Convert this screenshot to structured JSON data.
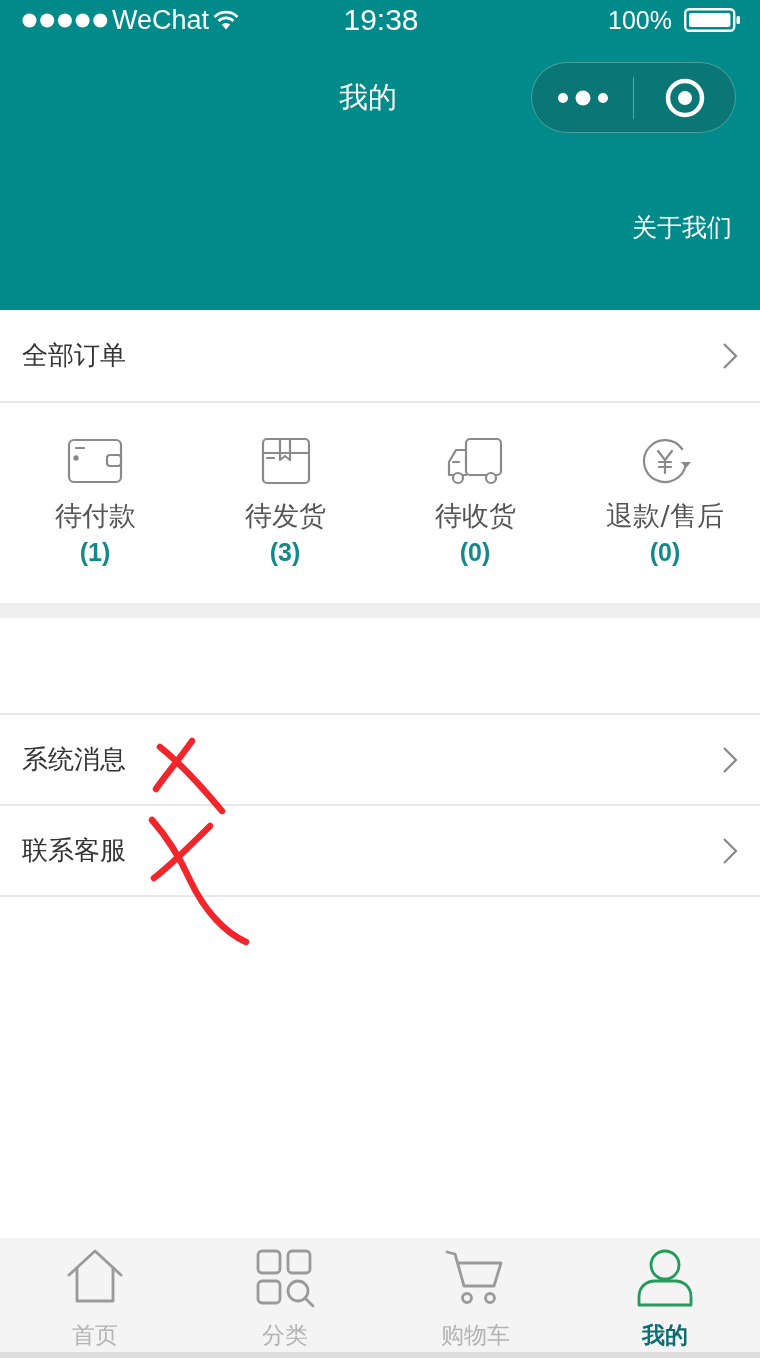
{
  "status_bar": {
    "carrier": "WeChat",
    "time": "19:38",
    "battery": "100%"
  },
  "header": {
    "title": "我的",
    "about_link": "关于我们"
  },
  "orders": {
    "all_label": "全部订单",
    "statuses": [
      {
        "kind": "wallet",
        "label": "待付款",
        "count": "(1)"
      },
      {
        "kind": "box",
        "label": "待发货",
        "count": "(3)"
      },
      {
        "kind": "truck",
        "label": "待收货",
        "count": "(0)"
      },
      {
        "kind": "refund",
        "label": "退款/售后",
        "count": "(0)"
      }
    ]
  },
  "menu": [
    {
      "label": "系统消息",
      "crossed_out": true
    },
    {
      "label": "联系客服",
      "crossed_out": true
    }
  ],
  "tabs": [
    {
      "kind": "home",
      "label": "首页",
      "selected": false
    },
    {
      "kind": "category",
      "label": "分类",
      "selected": false
    },
    {
      "kind": "cart",
      "label": "购物车",
      "selected": false
    },
    {
      "kind": "user",
      "label": "我的",
      "selected": true
    }
  ]
}
